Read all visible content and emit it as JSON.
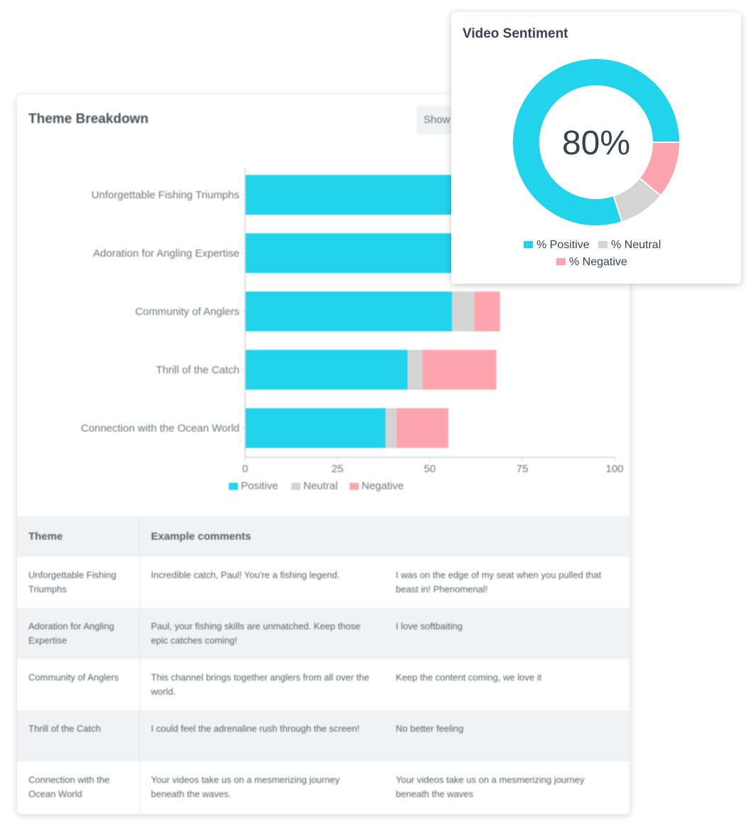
{
  "theme_card": {
    "title": "Theme Breakdown",
    "show_button": "Show"
  },
  "sentiment_card": {
    "title": "Video Sentiment",
    "center_value": "80%"
  },
  "colors": {
    "positive": "#22d3ec",
    "neutral": "#d4d4d4",
    "negative": "#fca5af"
  },
  "chart_data": [
    {
      "type": "bar",
      "orientation": "horizontal",
      "stacked": true,
      "categories": [
        "Unforgettable Fishing Triumphs",
        "Adoration for Angling Expertise",
        "Community of Anglers",
        "Thrill of the Catch",
        "Connection with the Ocean World"
      ],
      "series": [
        {
          "name": "Positive",
          "values": [
            90,
            88,
            56,
            44,
            38
          ]
        },
        {
          "name": "Neutral",
          "values": [
            2,
            2,
            6,
            4,
            3
          ]
        },
        {
          "name": "Negative",
          "values": [
            3,
            3,
            7,
            20,
            14
          ]
        }
      ],
      "xlim": [
        0,
        100
      ],
      "xticks": [
        "0",
        "25",
        "50",
        "75",
        "100"
      ],
      "legend": "bottom"
    },
    {
      "type": "pie",
      "donut": true,
      "labels": [
        "% Positive",
        "% Neutral",
        "% Negative"
      ],
      "values": [
        80,
        9,
        11
      ],
      "legend": "bottom"
    }
  ],
  "table": {
    "headers": [
      "Theme",
      "Example comments"
    ],
    "rows": [
      {
        "theme": "Unforgettable Fishing Triumphs",
        "c1": "Incredible catch, Paul! You're a fishing legend.",
        "c2": "I was on the edge of my seat when you pulled that beast in! Phenomenal!"
      },
      {
        "theme": "Adoration for Angling Expertise",
        "c1": "Paul, your fishing skills are unmatched. Keep those epic catches coming!",
        "c2": "I love softbaiting"
      },
      {
        "theme": "Community of Anglers",
        "c1": "This channel brings together anglers from all over the world.",
        "c2": "Keep the content coming, we love it"
      },
      {
        "theme": "Thrill of the Catch",
        "c1": "I could feel the adrenaline rush through the screen!",
        "c2": "No better feeling"
      },
      {
        "theme": "Connection with the Ocean World",
        "c1": "Your videos take us on a mesmerizing journey beneath the waves.",
        "c2": "Your videos take us on a mesmerizing journey beneath the waves"
      }
    ]
  }
}
